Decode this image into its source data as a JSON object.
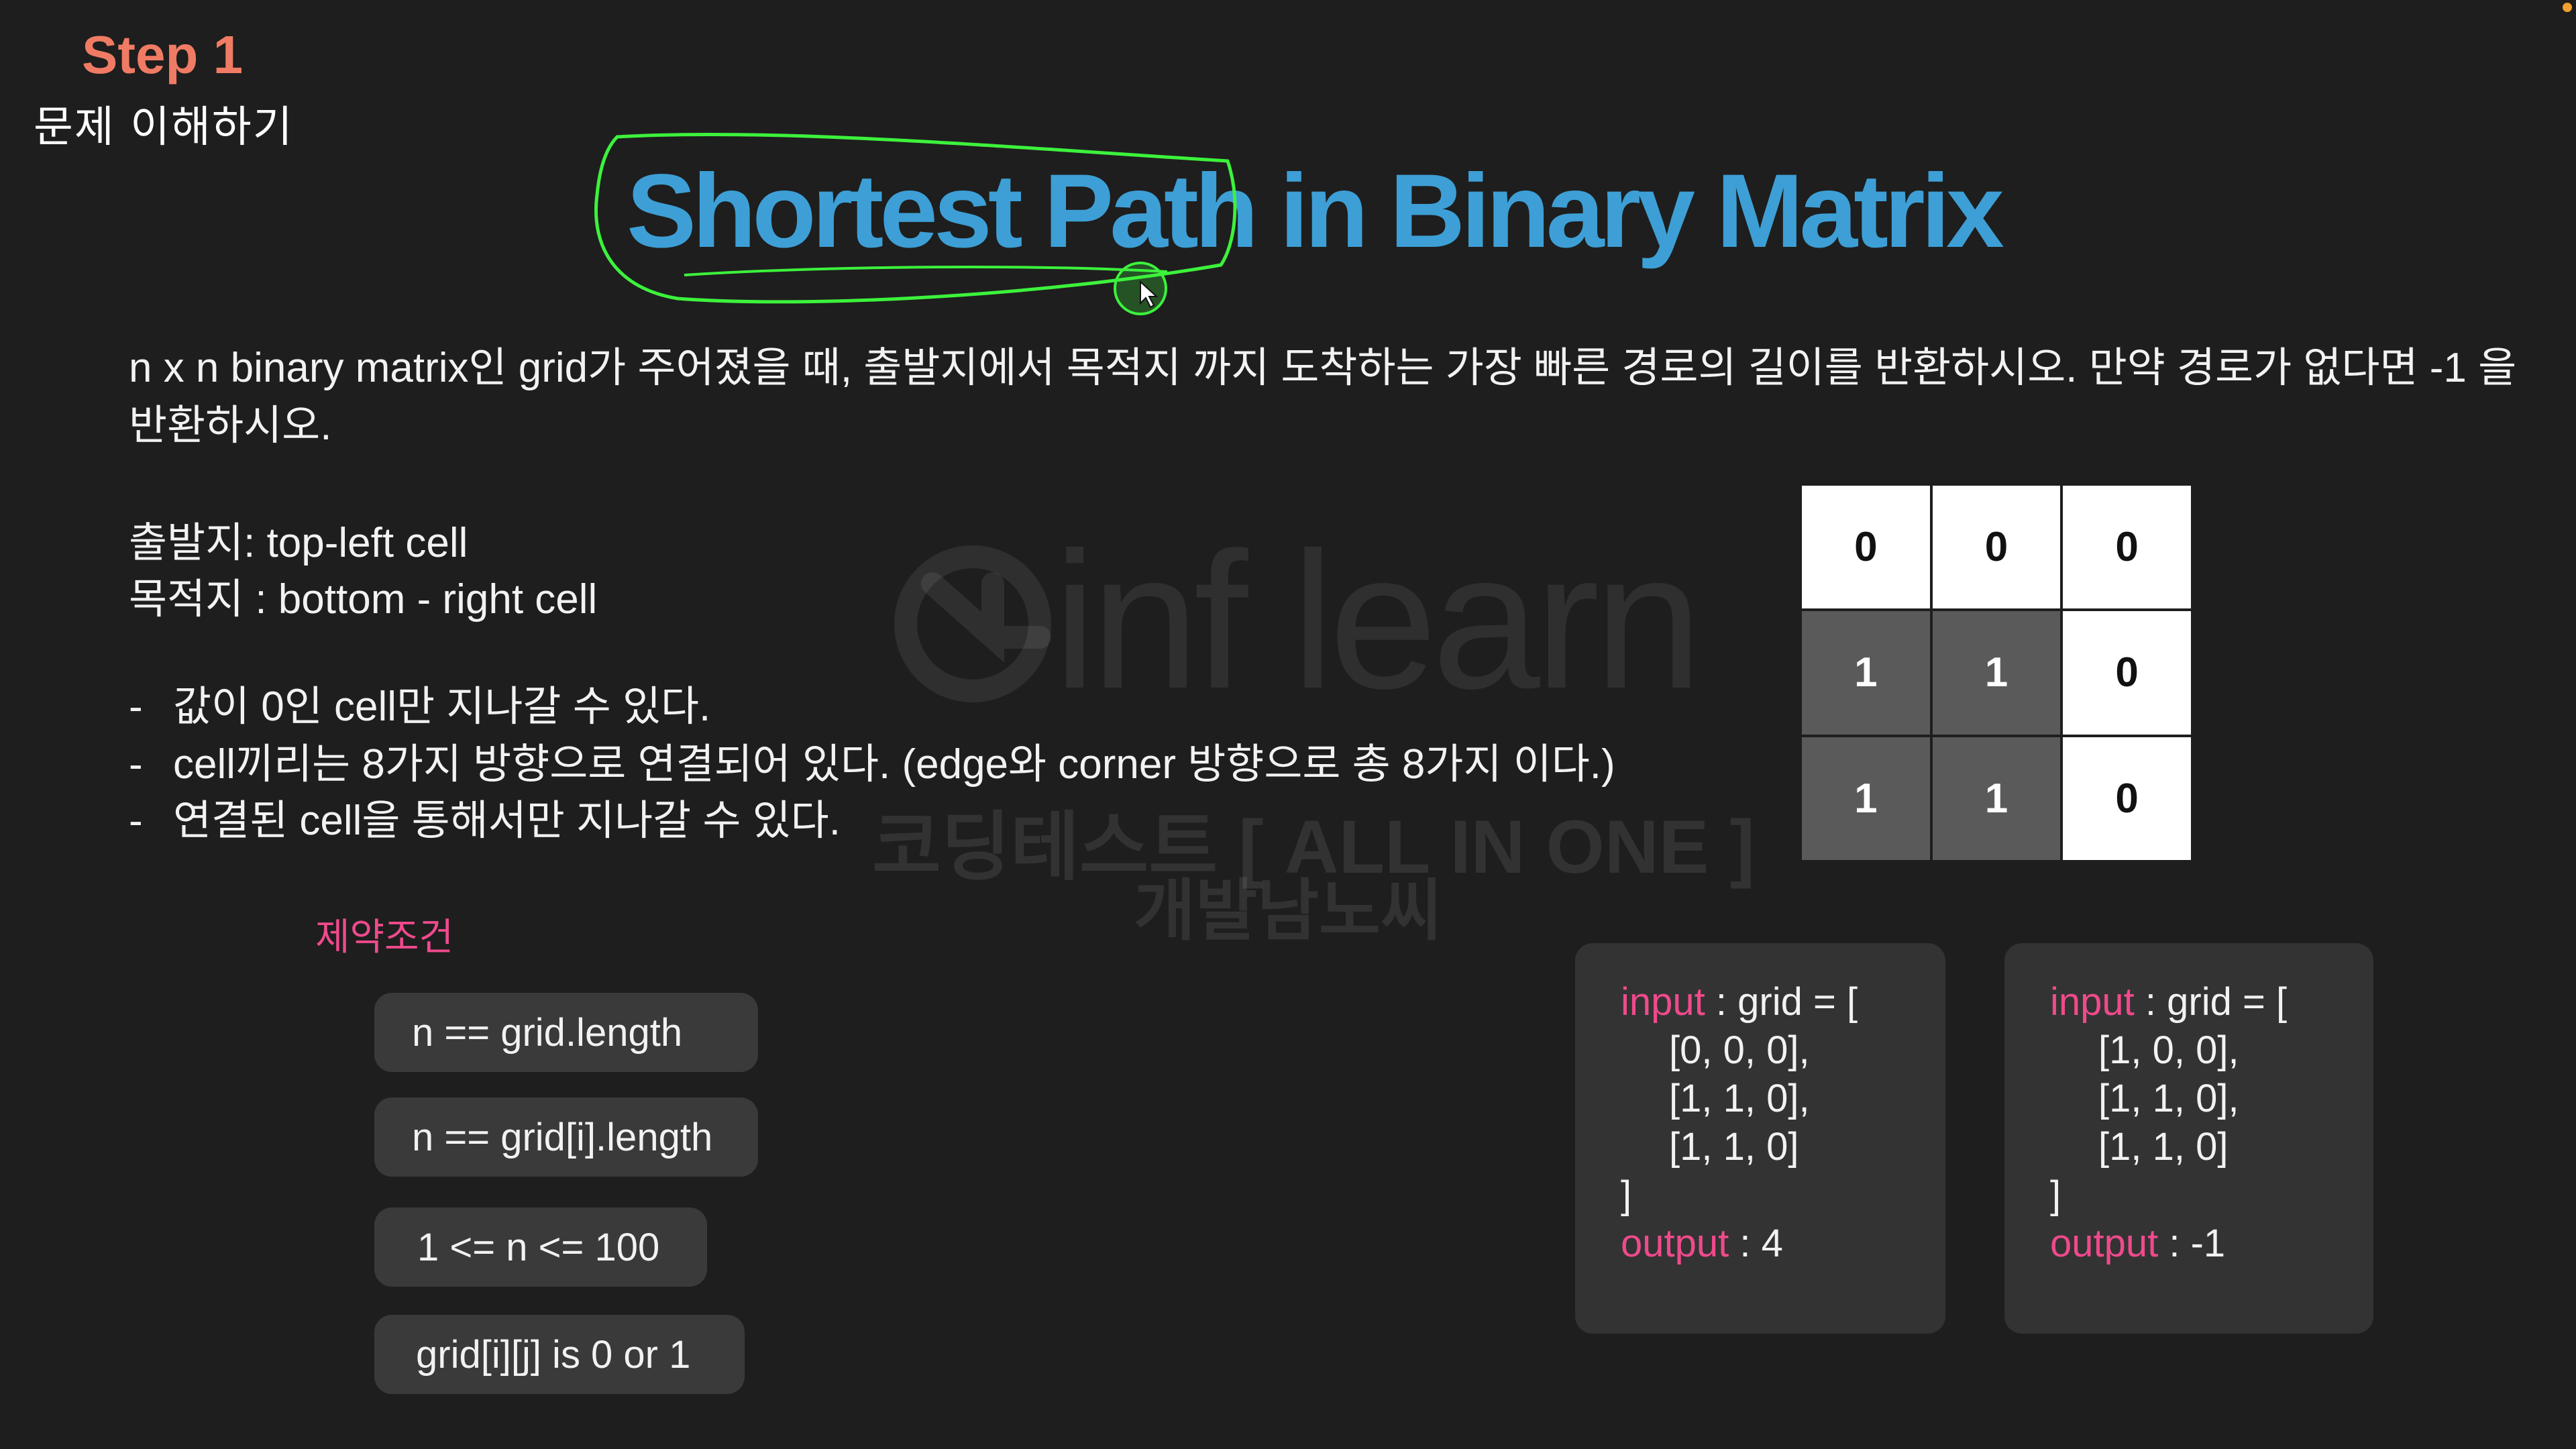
{
  "step": {
    "title": "Step 1",
    "subtitle": "문제 이해하기"
  },
  "title": {
    "text": "Shortest Path in Binary Matrix"
  },
  "description": {
    "text": "n x n binary matrix인 grid가 주어졌을 때, 출발지에서 목적지 까지 도착하는 가장 빠른 경로의 길이를 반환하시오. 만약 경로가 없다면 -1 을 반환하시오.",
    "start": "출발지: top-left cell",
    "end": "목적지 : bottom - right cell"
  },
  "rules": [
    "값이 0인 cell만 지나갈 수 있다.",
    "cell끼리는 8가지 방향으로 연결되어 있다. (edge와 corner 방향으로 총 8가지 이다.)",
    "연결된 cell을 통해서만 지나갈 수 있다."
  ],
  "bullet_char": "-",
  "watermark": {
    "line1": "코딩테스트 [ ALL IN ONE ]",
    "line2": "개발남노씨"
  },
  "matrix": [
    [
      "0",
      "0",
      "0"
    ],
    [
      "1",
      "1",
      "0"
    ],
    [
      "1",
      "1",
      "0"
    ]
  ],
  "constraints": {
    "title": "제약조건",
    "items": [
      "n == grid.length",
      "n == grid[i].length",
      "1 <= n <= 100",
      "grid[i][j] is 0 or 1"
    ]
  },
  "examples": [
    {
      "input_kw": "input",
      "input_rest": " : grid = [",
      "rows": [
        "[0, 0, 0],",
        "[1, 1, 0],",
        "[1, 1, 0]"
      ],
      "close": "]",
      "output_kw": "output",
      "output_rest": " : 4"
    },
    {
      "input_kw": "input",
      "input_rest": " : grid = [",
      "rows": [
        "[1, 0, 0],",
        "[1, 1, 0],",
        "[1, 1, 0]"
      ],
      "close": "]",
      "output_kw": "output",
      "output_rest": " : -1"
    }
  ],
  "colors": {
    "step": "#f07b64",
    "title": "#3d9fd6",
    "keyword": "#ef4a8c",
    "annotation": "#3cf23c",
    "cell_dark": "#5a5a5a",
    "card_bg": "#333333"
  }
}
